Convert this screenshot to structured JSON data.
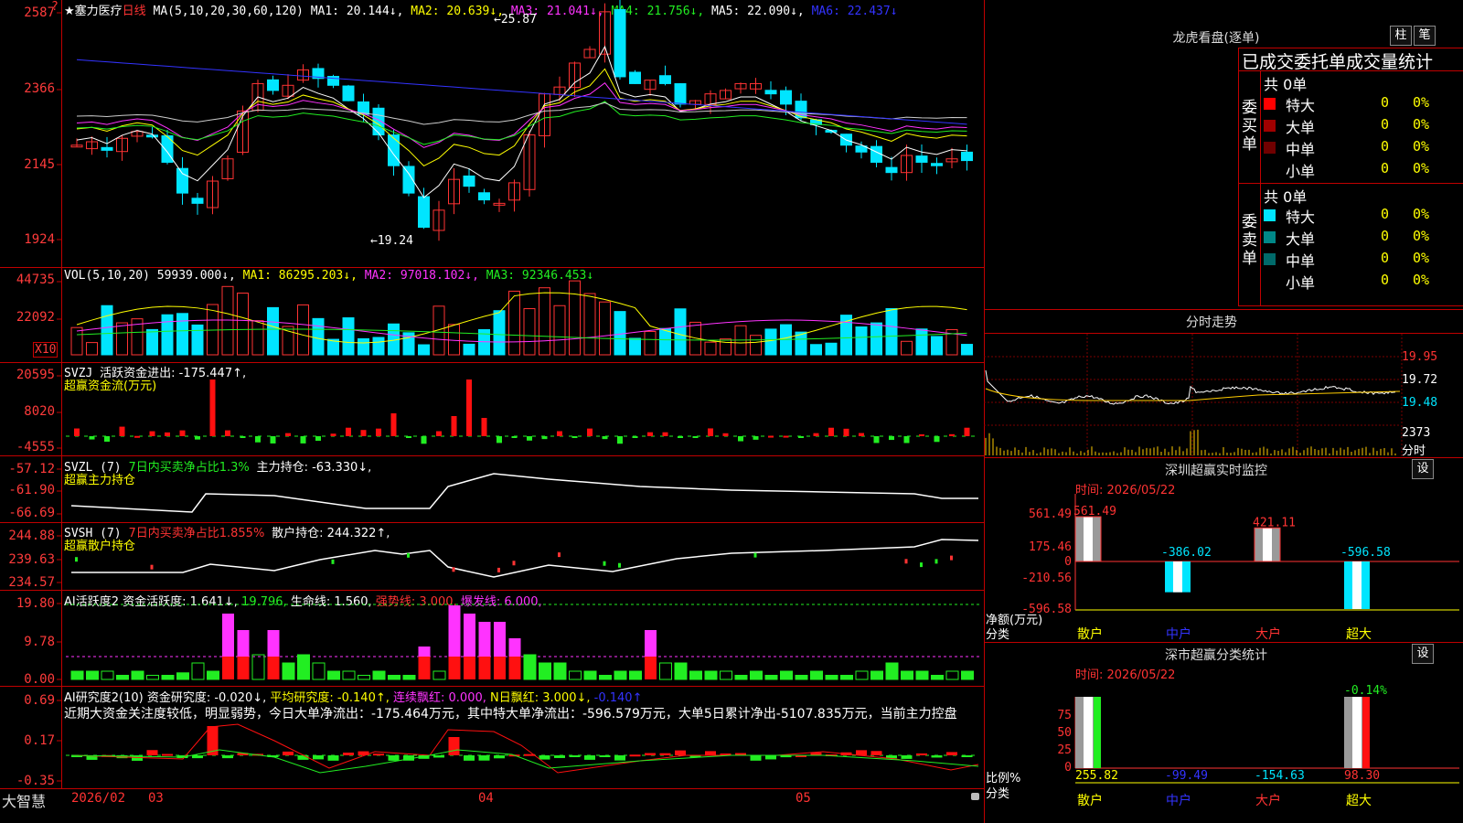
{
  "stock": {
    "star_name": "★塞力医疗",
    "period": "日线",
    "ma_label": "MA(5,10,20,30,60,120)",
    "ma1": "MA1: 20.144↓,",
    "ma2": "MA2: 20.639↓,",
    "ma3": "MA3: 21.041↓,",
    "ma4": "MA4: 21.756↓,",
    "ma5": "MA5: 22.090↓,",
    "ma6": "MA6: 22.437↓",
    "question_mark": "?",
    "high_annot": "←25.87",
    "low_annot": "←19.24",
    "y_labels": [
      "2587",
      "2366",
      "2145",
      "1924"
    ]
  },
  "volume": {
    "label": "VOL(5,10,20)",
    "value": "59939.000↓,",
    "ma1": "MA1: 86295.203↓,",
    "ma2": "MA2: 97018.102↓,",
    "ma3": "MA3: 92346.453↓",
    "y_labels": [
      "44735",
      "22092"
    ],
    "unit": "X10"
  },
  "svzj": {
    "label": "SVZJ",
    "line1": "活跃资金进出: -175.447↑,",
    "line2": "超赢资金流(万元)",
    "y_labels": [
      "20595",
      "8020",
      "-4555"
    ]
  },
  "svzl": {
    "label": "SVZL (7)",
    "ratio": "7日内买卖净占比1.3%",
    "hold": "主力持仓: -63.330↓,",
    "line2": "超赢主力持仓",
    "y_labels": [
      "-57.12",
      "-61.90",
      "-66.69"
    ]
  },
  "svsh": {
    "label": "SVSH (7)",
    "ratio": "7日内买卖净占比1.855%",
    "hold": "散户持仓: 244.322↑,",
    "line2": "超赢散户持仓",
    "y_labels": [
      "244.88",
      "239.63",
      "234.57"
    ]
  },
  "ai2": {
    "label": "AI活跃度2",
    "deg": "资金活跃度: 1.641↓,",
    "v2": "19.796,",
    "life": "生命线: 1.560,",
    "strong": "强势线: 3.000,",
    "burst": "爆发线: 6.000,",
    "y_labels": [
      "19.80",
      "9.78",
      "0.00"
    ]
  },
  "research": {
    "label": "AI研究度2(10)",
    "deg": "资金研究度: -0.020↓,",
    "avg": "平均研究度: -0.140↑,",
    "cont": "连续飘红: 0.000,",
    "ndays": "N日飘红: 3.000↓,",
    "last": "-0.140↑",
    "summary": "近期大资金关注度较低，明显弱势，今日大单净流出：-175.464万元，其中特大单净流出：-596.579万元，大单5日累计净出-5107.835万元，当前主力控盘",
    "y_labels": [
      "0.69",
      "0.17",
      "-0.35"
    ]
  },
  "footer": {
    "brand": "大智慧",
    "dates": [
      "2026/02",
      "03",
      "04",
      "05"
    ]
  },
  "lhb": {
    "title": "龙虎看盘(逐单)",
    "btn1": "柱",
    "btn2": "笔",
    "header": "已成交委托单成交量统计",
    "buy_total": "共 0单",
    "sell_total": "共 0单",
    "buy_label": "委买单",
    "sell_label": "委卖单",
    "buy_rows": [
      {
        "name": "特大",
        "val": "0",
        "pct": "0%",
        "color": "#ff0000"
      },
      {
        "name": "大单",
        "val": "0",
        "pct": "0%",
        "color": "#a00000"
      },
      {
        "name": "中单",
        "val": "0",
        "pct": "0%",
        "color": "#700000"
      },
      {
        "name": "小单",
        "val": "0",
        "pct": "0%",
        "color": ""
      }
    ],
    "sell_rows": [
      {
        "name": "特大",
        "val": "0",
        "pct": "0%",
        "color": "#00e5ff"
      },
      {
        "name": "大单",
        "val": "0",
        "pct": "0%",
        "color": "#008888"
      },
      {
        "name": "中单",
        "val": "0",
        "pct": "0%",
        "color": "#006a6a"
      },
      {
        "name": "小单",
        "val": "0",
        "pct": "0%",
        "color": ""
      }
    ]
  },
  "intraday": {
    "title": "分时走势",
    "y_labels": [
      "19.95",
      "19.72",
      "19.48"
    ],
    "vol_label": "2373",
    "time_label": "分时"
  },
  "monitor": {
    "title": "深圳超赢实时监控",
    "btn": "设",
    "time": "时间: 2026/05/22",
    "y_labels": [
      "561.49",
      "175.46",
      "0",
      "-210.56",
      "-596.58"
    ],
    "net_label": "净额(万元)",
    "cat_label": "分类",
    "categories": [
      "散户",
      "中户",
      "大户",
      "超大"
    ],
    "values": [
      "561.49",
      "-386.02",
      "421.11",
      "-596.58"
    ]
  },
  "stats": {
    "title": "深市超赢分类统计",
    "btn": "设",
    "time": "时间: 2026/05/22",
    "y_labels": [
      "75",
      "50",
      "25",
      "0"
    ],
    "ratio_label": "比例%",
    "cat_label": "分类",
    "top_label": "-0.14%",
    "categories": [
      "散户",
      "中户",
      "大户",
      "超大"
    ],
    "values": [
      "255.82",
      "-99.49",
      "-154.63",
      "98.30"
    ]
  }
}
